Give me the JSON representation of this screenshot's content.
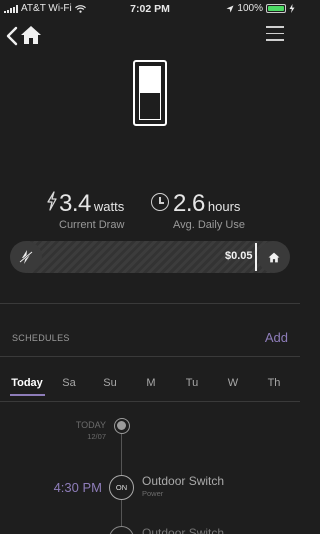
{
  "status_bar": {
    "carrier": "AT&T Wi-Fi",
    "time": "7:02 PM",
    "battery": "100%"
  },
  "device": {
    "switch_state": "off"
  },
  "stats": {
    "current_draw": {
      "value": "3.4",
      "unit": "watts",
      "label": "Current Draw"
    },
    "daily_use": {
      "value": "2.6",
      "unit": "hours",
      "label": "Avg. Daily Use"
    }
  },
  "cost": {
    "value": "$0.05"
  },
  "schedules": {
    "title": "SCHEDULES",
    "add_label": "Add",
    "tabs": [
      "Today",
      "Sa",
      "Su",
      "M",
      "Tu",
      "W",
      "Th"
    ],
    "active_tab": "Today",
    "timeline": {
      "day_label": "TODAY",
      "day_date": "12/07",
      "events": [
        {
          "time": "4:30 PM",
          "state": "ON",
          "name": "Outdoor Switch",
          "detail": "Power"
        },
        {
          "time": "",
          "state": "",
          "name": "Outdoor Switch",
          "detail": ""
        }
      ]
    }
  },
  "colors": {
    "accent": "#8e7db9",
    "background": "#1e1e1e",
    "battery": "#4cd964"
  }
}
